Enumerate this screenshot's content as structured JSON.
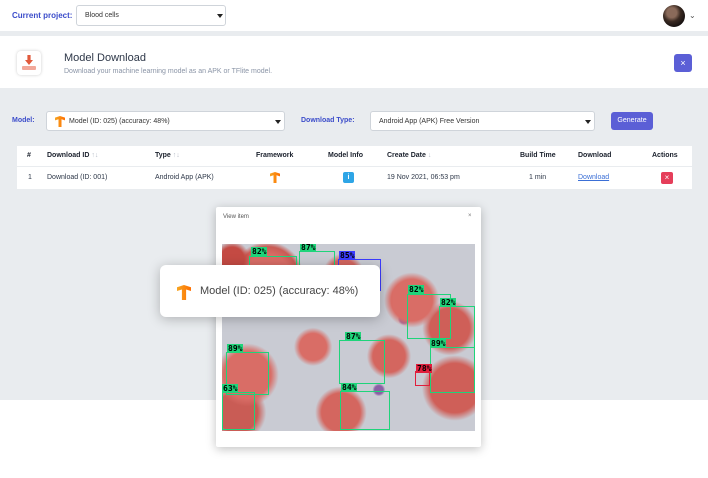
{
  "topbar": {
    "current_project_label": "Current project:",
    "project_value": "Blood cells"
  },
  "header": {
    "title": "Model Download",
    "subtitle": "Download your machine learning model as an APK or TFlite model.",
    "close_symbol": "×"
  },
  "controls": {
    "model_label": "Model:",
    "model_value": "Model (ID: 025) (accuracy: 48%)",
    "download_type_label": "Download Type:",
    "download_type_value": "Android App (APK) Free Version",
    "generate_button": "Generate"
  },
  "table": {
    "headers": {
      "num": "#",
      "download_id": "Download ID",
      "type": "Type",
      "framework": "Framework",
      "model_info": "Model Info",
      "create_date": "Create Date",
      "build_time": "Build Time",
      "download": "Download",
      "actions": "Actions"
    },
    "sort_symbols": {
      "unsorted": "↑↓",
      "desc": "↓"
    },
    "rows": [
      {
        "num": "1",
        "download_id": "Download (ID: 001)",
        "type": "Android App (APK)",
        "framework_icon": "tensorflow-icon",
        "model_info_icon": "info-icon",
        "create_date": "19 Nov 2021, 06:53 pm",
        "build_time": "1 min",
        "download_link": "Download",
        "action_icon": "delete-icon",
        "action_symbol": "×"
      }
    ]
  },
  "modal": {
    "title": "View item",
    "close_symbol": "×",
    "detections": [
      {
        "label": "82%",
        "color": "green"
      },
      {
        "label": "87%",
        "color": "green"
      },
      {
        "label": "85%",
        "color": "blue"
      },
      {
        "label": "82%",
        "color": "green"
      },
      {
        "label": "82%",
        "color": "green"
      },
      {
        "label": "87%",
        "color": "green"
      },
      {
        "label": "89%",
        "color": "green"
      },
      {
        "label": "89%",
        "color": "green"
      },
      {
        "label": "78%",
        "color": "red"
      },
      {
        "label": "63%",
        "color": "green"
      },
      {
        "label": "84%",
        "color": "green"
      }
    ]
  },
  "tooltip": {
    "text": "Model (ID: 025) (accuracy: 48%)"
  },
  "colors": {
    "accent": "#5b5fd6",
    "label_blue": "#3b4cca",
    "danger": "#e53e5a",
    "info": "#2ea5e6",
    "tensorflow_orange": "#ff8f00"
  }
}
